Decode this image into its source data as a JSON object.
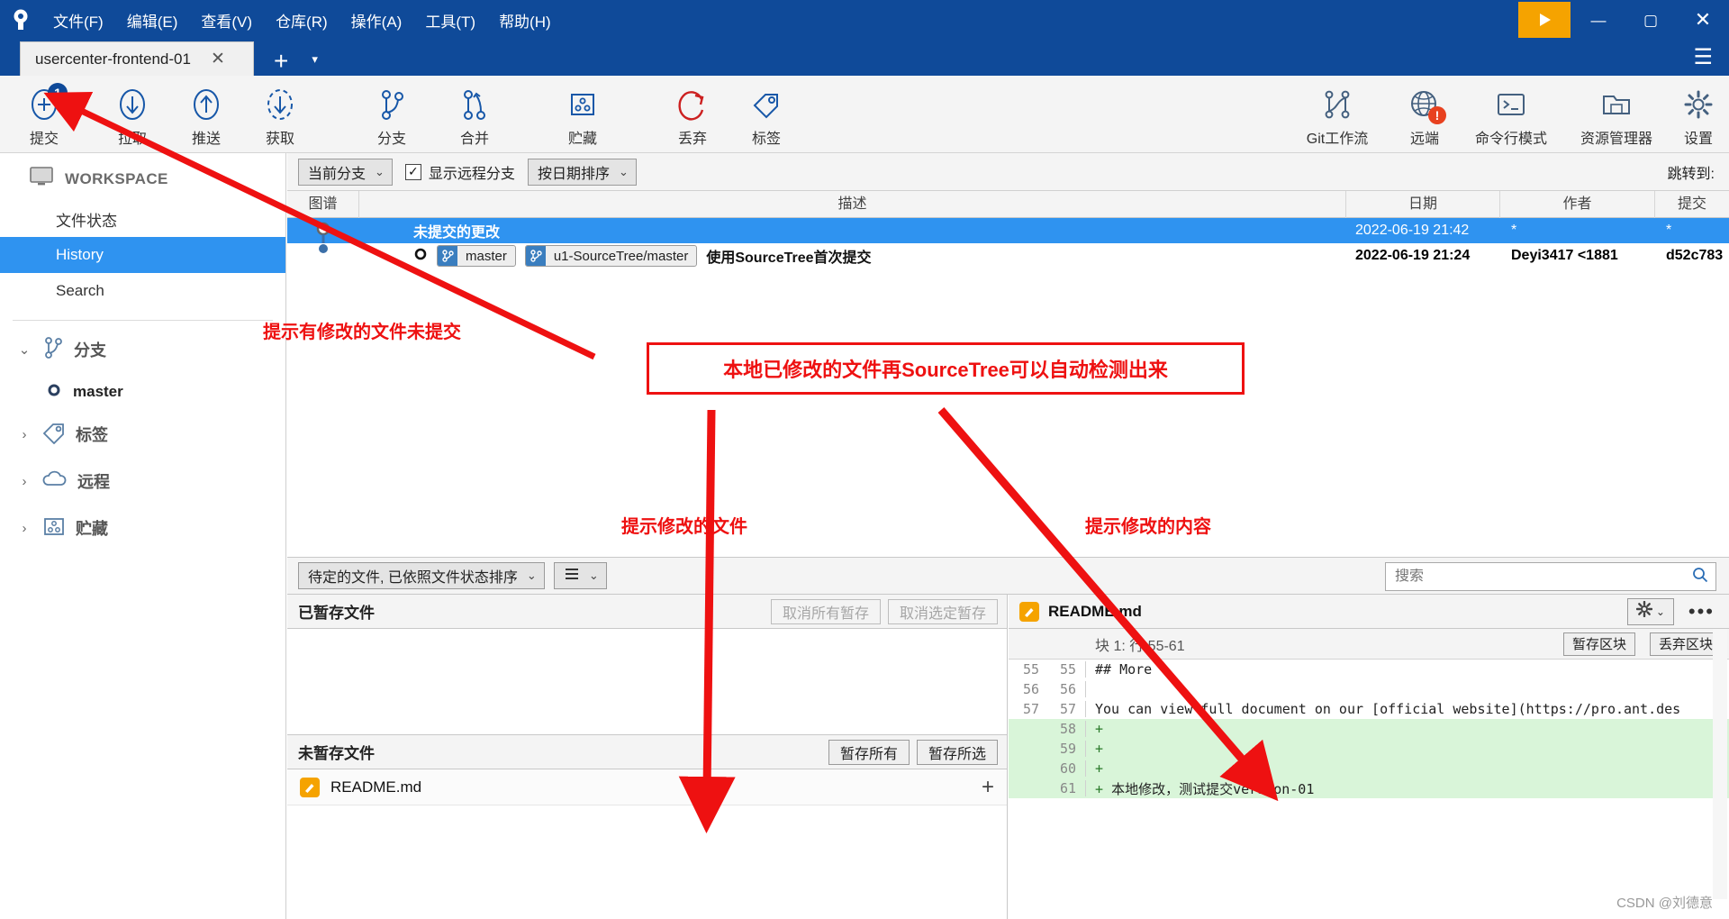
{
  "window": {
    "menu": [
      "文件(F)",
      "编辑(E)",
      "查看(V)",
      "仓库(R)",
      "操作(A)",
      "工具(T)",
      "帮助(H)"
    ],
    "minimize": "—",
    "maximize": "▢",
    "close": "✕"
  },
  "tabs": {
    "active_label": "usercenter-frontend-01",
    "close_glyph": "✕",
    "new_tab_glyph": "+",
    "caret_glyph": "▾",
    "hamburger_glyph": "☰"
  },
  "toolbar": {
    "left_items": [
      {
        "label": "提交",
        "icon": "commit-plus-icon",
        "badge": "1"
      },
      {
        "label": "拉取",
        "icon": "pull-down-arrow-icon",
        "badge": ""
      },
      {
        "label": "推送",
        "icon": "push-up-arrow-icon",
        "badge": ""
      },
      {
        "label": "获取",
        "icon": "fetch-dashed-arrow-icon",
        "badge": ""
      },
      {
        "label": "分支",
        "icon": "branch-icon",
        "badge": ""
      },
      {
        "label": "合并",
        "icon": "merge-icon",
        "badge": ""
      },
      {
        "label": "贮藏",
        "icon": "stash-box-icon",
        "badge": ""
      },
      {
        "label": "丢弃",
        "icon": "discard-refresh-icon",
        "badge": ""
      },
      {
        "label": "标签",
        "icon": "tag-icon",
        "badge": ""
      }
    ],
    "right_items": [
      {
        "label": "Git工作流",
        "icon": "gitflow-icon",
        "error": ""
      },
      {
        "label": "远端",
        "icon": "globe-remote-icon",
        "error": "!"
      },
      {
        "label": "命令行模式",
        "icon": "terminal-icon",
        "error": ""
      },
      {
        "label": "资源管理器",
        "icon": "folder-explorer-icon",
        "error": ""
      },
      {
        "label": "设置",
        "icon": "gear-settings-icon",
        "error": ""
      }
    ]
  },
  "sidebar": {
    "workspace_label": "WORKSPACE",
    "items": [
      {
        "label": "文件状态",
        "selected": false
      },
      {
        "label": "History",
        "selected": true
      },
      {
        "label": "Search",
        "selected": false
      }
    ],
    "groups": [
      {
        "label": "分支",
        "icon": "branch-icon",
        "expanded": true,
        "caret": "⌄"
      },
      {
        "label": "标签",
        "icon": "tag-icon",
        "expanded": false,
        "caret": "›"
      },
      {
        "label": "远程",
        "icon": "cloud-icon",
        "expanded": false,
        "caret": "›"
      },
      {
        "label": "贮藏",
        "icon": "stash-box-icon",
        "expanded": false,
        "caret": "›"
      }
    ],
    "branch": "master"
  },
  "filterbar": {
    "branch_filter": "当前分支",
    "show_remote_label": "显示远程分支",
    "show_remote_checked": true,
    "sort_order": "按日期排序",
    "jump_to_label": "跳转到:",
    "caret": "⌄",
    "check_glyph": "✓"
  },
  "commit_table": {
    "columns": [
      "图谱",
      "描述",
      "日期",
      "作者",
      "提交"
    ],
    "rows": [
      {
        "type": "uncommitted",
        "description": "未提交的更改",
        "refs": [],
        "date": "2022-06-19 21:42",
        "author": "*",
        "commit": "*",
        "selected": true
      },
      {
        "type": "commit",
        "description": "使用SourceTree首次提交",
        "refs": [
          "master",
          "u1-SourceTree/master"
        ],
        "date": "2022-06-19 21:24",
        "author": "Deyi3417 <1881",
        "commit": "d52c783",
        "selected": false
      }
    ]
  },
  "file_pane": {
    "sort_combo": "待定的文件, 已依照文件状态排序",
    "view_combo_icon": "list-view-icon",
    "caret": "⌄",
    "staged": {
      "title": "已暂存文件",
      "unstage_all_label": "取消所有暂存",
      "unstage_selected_label": "取消选定暂存",
      "files": []
    },
    "unstaged": {
      "title": "未暂存文件",
      "stage_all_label": "暂存所有",
      "stage_selected_label": "暂存所选",
      "files": [
        {
          "name": "README.md",
          "status": "modified",
          "add_glyph": "+"
        }
      ]
    }
  },
  "search": {
    "placeholder": "搜索",
    "value": "",
    "icon": "search-icon"
  },
  "diff_pane": {
    "file_name": "README.md",
    "gear_icon": "gear-icon",
    "caret": "⌄",
    "more_glyph": "•••",
    "hunk_label": "块 1: 行 55-61",
    "stage_hunk_label": "暂存区块",
    "discard_hunk_label": "丢弃区块",
    "lines": [
      {
        "old": "55",
        "new": "55",
        "marker": "",
        "text": "## More",
        "type": "context"
      },
      {
        "old": "56",
        "new": "56",
        "marker": "",
        "text": "",
        "type": "context"
      },
      {
        "old": "57",
        "new": "57",
        "marker": "",
        "text": "You can view full document on our [official website](https://pro.ant.des",
        "type": "context"
      },
      {
        "old": "",
        "new": "58",
        "marker": "+",
        "text": "",
        "type": "add"
      },
      {
        "old": "",
        "new": "59",
        "marker": "+",
        "text": "",
        "type": "add"
      },
      {
        "old": "",
        "new": "60",
        "marker": "+",
        "text": "",
        "type": "add"
      },
      {
        "old": "",
        "new": "61",
        "marker": "+",
        "text": "本地修改，测试提交version-01",
        "type": "add"
      }
    ]
  },
  "annotations": [
    {
      "id": "anno-uncommitted",
      "text": "提示有修改的文件未提交"
    },
    {
      "id": "anno-autodetect",
      "text": "本地已修改的文件再SourceTree可以自动检测出来"
    },
    {
      "id": "anno-modified-file",
      "text": "提示修改的文件"
    },
    {
      "id": "anno-modified-content",
      "text": "提示修改的内容"
    }
  ],
  "watermark": "CSDN @刘德意",
  "colors": {
    "titlebar": "#0f4a99",
    "accent_blue": "#2f93f0",
    "annotation_red": "#ee1111",
    "add_green": "#d9f5d9",
    "warn_orange": "#f5a300"
  }
}
